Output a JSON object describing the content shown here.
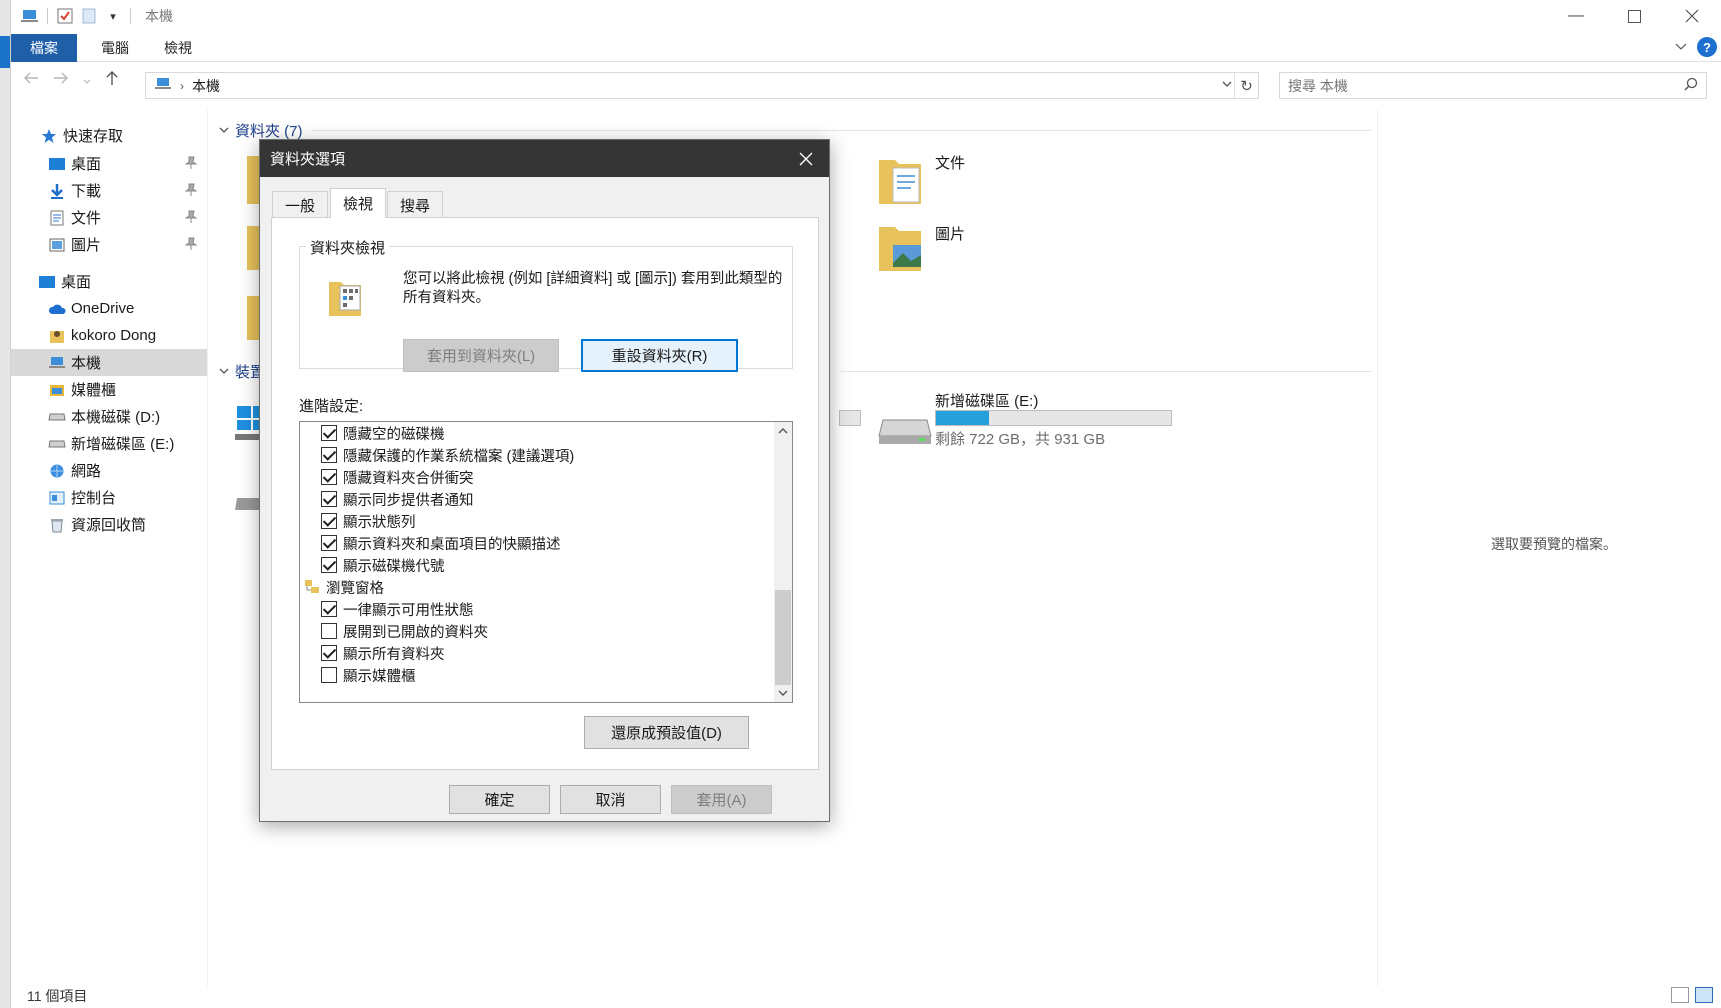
{
  "window": {
    "title": "本機"
  },
  "ribbon": {
    "tabs": [
      {
        "label": "檔案"
      },
      {
        "label": "電腦"
      },
      {
        "label": "檢視"
      }
    ],
    "help": "?"
  },
  "address": {
    "path": "本機"
  },
  "search": {
    "placeholder": "搜尋 本機"
  },
  "sidebar": {
    "items": [
      {
        "label": "快速存取",
        "icon": "star-icon"
      },
      {
        "label": "桌面",
        "icon": "desktop-icon",
        "pinned": true
      },
      {
        "label": "下載",
        "icon": "download-icon",
        "pinned": true
      },
      {
        "label": "文件",
        "icon": "document-icon",
        "pinned": true
      },
      {
        "label": "圖片",
        "icon": "pictures-icon",
        "pinned": true
      },
      {
        "label": "桌面",
        "icon": "desktop-icon"
      },
      {
        "label": "OneDrive",
        "icon": "cloud-icon"
      },
      {
        "label": "kokoro Dong",
        "icon": "user-folder-icon"
      },
      {
        "label": "本機",
        "icon": "computer-icon",
        "selected": true
      },
      {
        "label": "媒體櫃",
        "icon": "library-icon"
      },
      {
        "label": "本機磁碟 (D:)",
        "icon": "drive-icon"
      },
      {
        "label": "新增磁碟區 (E:)",
        "icon": "drive-icon"
      },
      {
        "label": "網路",
        "icon": "network-icon"
      },
      {
        "label": "控制台",
        "icon": "control-panel-icon"
      },
      {
        "label": "資源回收筒",
        "icon": "recycle-bin-icon"
      }
    ]
  },
  "main": {
    "folders_header": "資料夾 (7)",
    "devices_header": "裝置",
    "folders": [
      {
        "label": "文件"
      },
      {
        "label": "圖片"
      }
    ],
    "drive_e": {
      "label": "新增磁碟區 (E:)",
      "free_text": "剩餘 722 GB，共 931 GB",
      "used_fraction": 0.224
    },
    "preview_text": "選取要預覽的檔案。"
  },
  "status": {
    "count": "11 個項目"
  },
  "dialog": {
    "title": "資料夾選項",
    "tabs": [
      {
        "label": "一般"
      },
      {
        "label": "檢視"
      },
      {
        "label": "搜尋"
      }
    ],
    "folder_views": {
      "legend": "資料夾檢視",
      "description": "您可以將此檢視 (例如 [詳細資料] 或 [圖示]) 套用到此類型的所有資料夾。",
      "apply_button": "套用到資料夾(L)",
      "reset_button": "重設資料夾(R)"
    },
    "advanced_label": "進階設定:",
    "settings": [
      {
        "label": "隱藏空的磁碟機",
        "checked": true
      },
      {
        "label": "隱藏保護的作業系統檔案 (建議選項)",
        "checked": true
      },
      {
        "label": "隱藏資料夾合併衝突",
        "checked": true
      },
      {
        "label": "顯示同步提供者通知",
        "checked": true
      },
      {
        "label": "顯示狀態列",
        "checked": true
      },
      {
        "label": "顯示資料夾和桌面項目的快顯描述",
        "checked": true
      },
      {
        "label": "顯示磁碟機代號",
        "checked": true
      },
      {
        "label": "瀏覽窗格",
        "group": true
      },
      {
        "label": "一律顯示可用性狀態",
        "checked": true
      },
      {
        "label": "展開到已開啟的資料夾",
        "checked": false
      },
      {
        "label": "顯示所有資料夾",
        "checked": true
      },
      {
        "label": "顯示媒體櫃",
        "checked": false
      }
    ],
    "restore_button": "還原成預設值(D)",
    "ok_button": "確定",
    "cancel_button": "取消",
    "apply_button": "套用(A)"
  },
  "colors": {
    "accent": "#1f5fa8",
    "progress": "#26a0da",
    "dialog_title": "#353535"
  }
}
